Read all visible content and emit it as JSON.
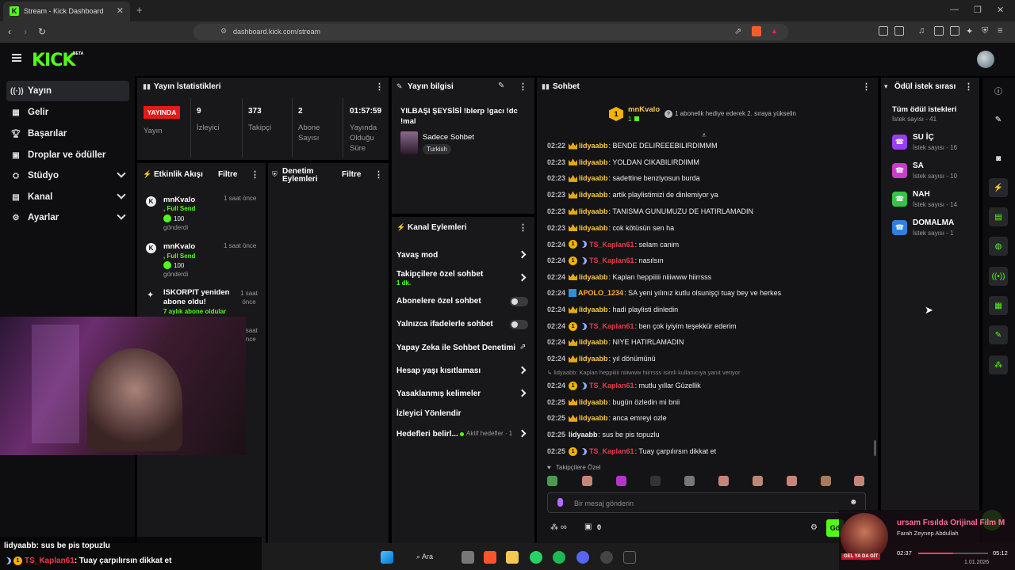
{
  "browser": {
    "tab_title": "Stream - Kick Dashboard",
    "url": "dashboard.kick.com/stream"
  },
  "app": {
    "logo": "KICK",
    "beta": "BETA"
  },
  "sidebar": {
    "items": [
      {
        "label": "Yayın",
        "icon": "live-icon"
      },
      {
        "label": "Gelir",
        "icon": "money-icon"
      },
      {
        "label": "Başarılar",
        "icon": "trophy-icon"
      },
      {
        "label": "Droplar ve ödüller",
        "icon": "gift-icon"
      },
      {
        "label": "Stüdyo",
        "icon": "studio-icon"
      },
      {
        "label": "Kanal",
        "icon": "channel-icon"
      },
      {
        "label": "Ayarlar",
        "icon": "gear-icon"
      }
    ]
  },
  "stats": {
    "title": "Yayın İstatistikleri",
    "live_badge": "YAYINDA",
    "live_label": "Yayın",
    "viewers_value": "9",
    "viewers_label": "İzleyici",
    "followers_value": "373",
    "followers_label": "Takipçi",
    "subs_value": "2",
    "subs_label": "Abone Sayısı",
    "duration_value": "01:57:59",
    "duration_label": "Yayında Olduğu Süre"
  },
  "info": {
    "title": "Yayın bilgisi",
    "stream_title": "YILBAŞI ŞEYSİSİ !blerp !gacı !dc !mal",
    "category": "Sadece Sohbet",
    "tag": "Turkish"
  },
  "activity": {
    "title": "Etkinlik Akışı",
    "filter": "Filtre",
    "items": [
      {
        "name": "mnKvalo",
        "line2": ", Full Send",
        "amount": "100",
        "line3": "gönderdi",
        "time": "1 saat önce"
      },
      {
        "name": "mnKvalo",
        "line2": ", Full Send",
        "amount": "100",
        "line3": "gönderdi",
        "time": "1 saat önce"
      },
      {
        "name": "ISKORPIT yeniden abone oldu!",
        "line2": "7 aylık abone oldular",
        "time": "1 saat önce"
      },
      {
        "time": "1 saat önce"
      }
    ]
  },
  "moderation": {
    "title": "Denetim Eylemleri",
    "filter": "Filtre"
  },
  "channel_actions": {
    "title": "Kanal Eylemleri",
    "items": [
      {
        "label": "Yavaş mod"
      },
      {
        "label": "Takipçilere özel sohbet",
        "sub": "1 dk."
      },
      {
        "label": "Abonelere özel sohbet"
      },
      {
        "label": "Yalnızca ifadelerle sohbet"
      },
      {
        "label": "Yapay Zeka ile Sohbet Denetimi"
      },
      {
        "label": "Hesap yaşı kısıtlaması"
      },
      {
        "label": "Yasaklanmış kelimeler"
      },
      {
        "label": "İzleyici Yönlendir"
      },
      {
        "label": "Hedefleri belirl...",
        "sub": "Aktif hedefler · 1"
      }
    ]
  },
  "chat": {
    "title": "Sohbet",
    "pinned_user": "mnKvalo",
    "pinned_count": "1",
    "pinned_text": "1 abonelik hediye ederek 2. sıraya yükselin",
    "messages": [
      {
        "time": "02:22",
        "user": "lidyaabb",
        "text": ": BENDE DELIREEEBILIRDIMMM",
        "type": "crown"
      },
      {
        "time": "02:23",
        "user": "lidyaabb",
        "text": ": YOLDAN CIKABILIRDIIMM",
        "type": "crown"
      },
      {
        "time": "02:23",
        "user": "lidyaabb",
        "text": ": sadettine benziyosun burda",
        "type": "crown"
      },
      {
        "time": "02:23",
        "user": "lidyaabb",
        "text": ": artik playlistimizi de dinlemiyor ya",
        "type": "crown"
      },
      {
        "time": "02:23",
        "user": "lidyaabb",
        "text": ": TANISMA GUNUMUZU DE HATIRLAMADIN",
        "type": "crown"
      },
      {
        "time": "02:23",
        "user": "lidyaabb",
        "text": ": cok kötüsün sen ha",
        "type": "crown"
      },
      {
        "time": "02:24",
        "user": "TS_Kaplan61",
        "text": ": selam canim",
        "type": "red"
      },
      {
        "time": "02:24",
        "user": "TS_Kaplan61",
        "text": ": nasılsın",
        "type": "red"
      },
      {
        "time": "02:24",
        "user": "lidyaabb",
        "text": ": Kaplan heppiiiii niiiwww hiirrsss",
        "type": "crown"
      },
      {
        "time": "02:24",
        "user": "APOLO_1234",
        "text": ": SA yeni yılınız kutlu olsunişçi tuay bey ve herkes",
        "type": "apolo"
      },
      {
        "time": "02:24",
        "user": "lidyaabb",
        "text": ": hadi playlisti dinledin",
        "type": "crown"
      },
      {
        "time": "02:24",
        "user": "TS_Kaplan61",
        "text": ": ben çok iyiyim teşekkür ederim",
        "type": "red"
      },
      {
        "time": "02:24",
        "user": "lidyaabb",
        "text": ": NIYE HATIRLAMADIN",
        "type": "crown"
      },
      {
        "time": "02:24",
        "user": "lidyaabb",
        "text": ": yıl dönümünü",
        "type": "crown"
      },
      {
        "reply": "↳ lidyaabb: Kaplan heppiiiii niiiwww hiirrsss isimli kullanıcıya yanıt veriyor"
      },
      {
        "time": "02:24",
        "user": "TS_Kaplan61",
        "text": ": mutlu yıllar Güzellik",
        "type": "red"
      },
      {
        "time": "02:25",
        "user": "lidyaabb",
        "text": ": bugün özledin mi bnii",
        "type": "crown"
      },
      {
        "time": "02:25",
        "user": "lidyaabb",
        "text": ": anca emreyi ozle",
        "type": "crown"
      },
      {
        "time": "02:25",
        "user": "lidyaabb",
        "text": ": sus be pis topuzlu",
        "type": "plain"
      },
      {
        "time": "02:25",
        "user": "TS_Kaplan61",
        "text": ": Tuay çarpılırsın dikkat et",
        "type": "red"
      }
    ],
    "followers_only": "Takipçilere Özel",
    "input_placeholder": "Bir mesaj gönderin",
    "points": "∞",
    "gifts": "0",
    "send": "Gö"
  },
  "rewards": {
    "title": "Ödül istek sırası",
    "all": "Tüm ödül istekleri",
    "all_count": "İstek sayısı - 41",
    "items": [
      {
        "name": "SU İÇ",
        "count": "İstek sayısı - 16",
        "color": "#9b3df0"
      },
      {
        "name": "SA",
        "count": "İstek sayısı - 10",
        "color": "#c93ec9"
      },
      {
        "name": "NAH",
        "count": "İstek sayısı - 14",
        "color": "#37c24a"
      },
      {
        "name": "DOMALMA",
        "count": "İstek sayısı - 1",
        "color": "#2f7fe0"
      }
    ]
  },
  "overlay": {
    "line1_user": "lidyaabb",
    "line1_text": ": sus be pis topuzlu",
    "line2_user": "TS_Kaplan61",
    "line2_text": ": Tuay çarpılırsın dikkat et",
    "media_title": "ursam Fısılda Orijinal Film M",
    "media_artist": "Farah Zeynep Abdullah",
    "media_elapsed": "02:37",
    "media_total": "05:12",
    "media_progress": 0.5,
    "album_label": "GEL YA DA GİT",
    "date": "1.01.2026"
  },
  "taskbar": {
    "search": "Ara"
  }
}
